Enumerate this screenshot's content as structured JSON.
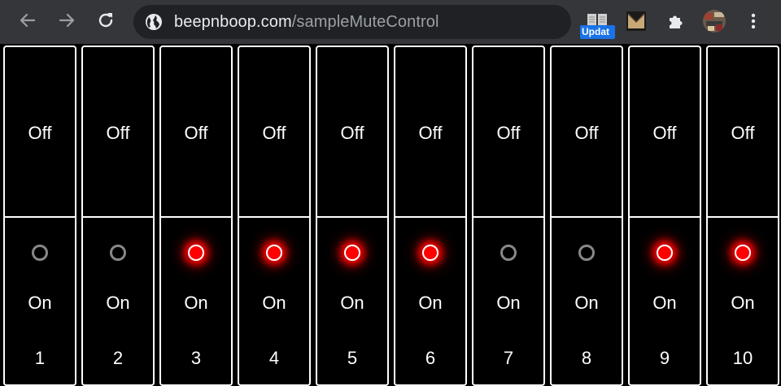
{
  "browser": {
    "url_host": "beepnboop.com",
    "url_path": "/sampleMuteControl",
    "update_badge": "Updat",
    "colors": {
      "toolbar": "#35363a",
      "omnibox": "#202124",
      "badge": "#1a73e8"
    }
  },
  "channels": [
    {
      "number": "1",
      "off_label": "Off",
      "on_label": "On",
      "active": false
    },
    {
      "number": "2",
      "off_label": "Off",
      "on_label": "On",
      "active": false
    },
    {
      "number": "3",
      "off_label": "Off",
      "on_label": "On",
      "active": true
    },
    {
      "number": "4",
      "off_label": "Off",
      "on_label": "On",
      "active": true
    },
    {
      "number": "5",
      "off_label": "Off",
      "on_label": "On",
      "active": true
    },
    {
      "number": "6",
      "off_label": "Off",
      "on_label": "On",
      "active": true
    },
    {
      "number": "7",
      "off_label": "Off",
      "on_label": "On",
      "active": false
    },
    {
      "number": "8",
      "off_label": "Off",
      "on_label": "On",
      "active": false
    },
    {
      "number": "9",
      "off_label": "Off",
      "on_label": "On",
      "active": true
    },
    {
      "number": "10",
      "off_label": "Off",
      "on_label": "On",
      "active": true
    }
  ],
  "colors": {
    "led_on": "#ff0000",
    "led_off": "#888888",
    "border": "#ffffff",
    "background": "#000000"
  }
}
